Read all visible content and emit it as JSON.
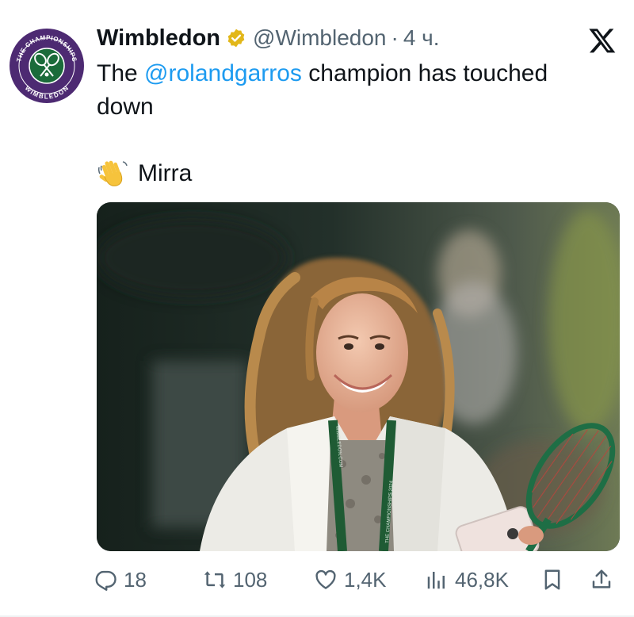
{
  "post": {
    "author_name": "Wimbledon",
    "author_handle": "@Wimbledon",
    "separator": "·",
    "time": "4 ч.",
    "verified": true,
    "avatar_logo_text": {
      "top": "THE CHAMPIONSHIPS",
      "bottom": "WIMBLEDON"
    },
    "text_prefix": "The ",
    "mention": "@rolandgarros",
    "text_suffix": " champion has touched down",
    "second_line_emoji": "waving-hand",
    "second_line_text": "Mirra",
    "photo_lanyard_text": [
      "WIMBLEDON.COM",
      "THE CHAMPIONSHIPS 2024"
    ]
  },
  "actions": {
    "replies": "18",
    "reposts": "108",
    "likes": "1,4K",
    "views": "46,8K"
  },
  "colors": {
    "accent": "#1d9bf0",
    "muted": "#536471",
    "text": "#0f1419",
    "brand_purple": "#4d2a72",
    "brand_green": "#1b6b3a",
    "verified_gold": "#e2b719"
  },
  "icons": [
    "x-logo-icon",
    "verified-badge-icon",
    "waving-hand-icon",
    "reply-icon",
    "repost-icon",
    "like-icon",
    "views-icon",
    "bookmark-icon",
    "share-icon"
  ]
}
